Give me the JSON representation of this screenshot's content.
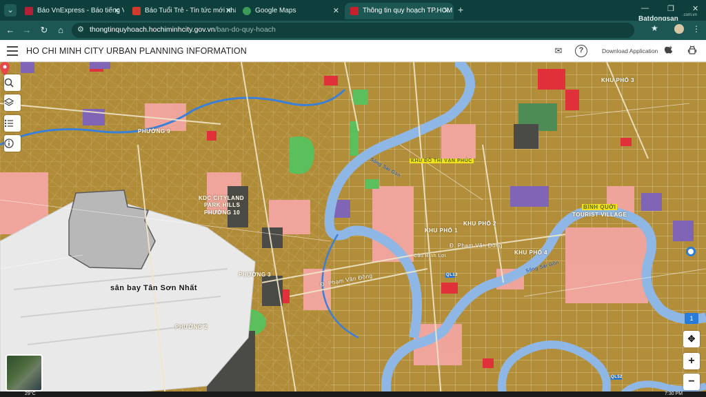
{
  "browser": {
    "tabs": [
      {
        "title": "Báo VnExpress - Báo tiếng Việt",
        "favicon_color": "#b2203a",
        "active": false
      },
      {
        "title": "Báo Tuổi Trẻ - Tin tức mới nhất",
        "favicon_color": "#d23a2a",
        "active": false
      },
      {
        "title": "Google Maps",
        "favicon_color": "#3a9b5b",
        "active": false
      },
      {
        "title": "Thông tin quy hoạch TP.HCM",
        "favicon_color": "#c8202b",
        "active": true
      }
    ],
    "new_tab_label": "+",
    "url_host": "thongtinquyhoach.hochiminhcity.gov.vn",
    "url_path": "/ban-do-quy-hoach",
    "watermark_brand": "Batdongsan",
    "watermark_sub": ".com.vn"
  },
  "site": {
    "title": "HO CHI MINH CITY URBAN PLANNING INFORMATION",
    "download_label": "Download Application"
  },
  "map": {
    "labels": {
      "airport": "sân bay Tân Sơn Nhất",
      "phuong10": "PHƯỜNG 10",
      "cityland": "KDC CITYLAND",
      "parkhills": "PARK HILLS",
      "phuong3": "PHƯỜNG 3",
      "phuong2": "PHƯỜNG 2",
      "phuong9": "PHƯỜNG 9",
      "khupho3": "KHU PHỐ 3",
      "khupho1": "KHU PHỐ 1",
      "khupho2": "KHU PHỐ 2",
      "khupho4": "KHU PHỐ 4",
      "kdtvanphuc": "KHU ĐÔ THỊ VẠN PHÚC",
      "binhquoi": "BÌNH QUỚI",
      "touristvillage": "TOURIST VILLAGE",
      "songsaigon": "Sông Sài Gòn",
      "songsaigon2": "Sông Sài Gòn",
      "phamvandong": "Đ. Phạm Văn Đồng",
      "phamvandong2": "Đ. Phạm Văn Đồng",
      "caubinhloi": "Cầu Bình Lợi",
      "ql13": "QL13",
      "ql52": "QL52"
    },
    "zoom_in_label": "+",
    "zoom_out_label": "−",
    "badge_count": "1"
  },
  "taskbar": {
    "temp": "29°C",
    "time": "7:30 PM"
  },
  "icons": {
    "search": "search-icon",
    "layers": "layers-icon",
    "legend": "legend-icon",
    "info": "info-icon",
    "mail": "mail-icon",
    "help": "help-icon",
    "apple": "apple-icon",
    "android": "android-icon",
    "locate": "locate-icon"
  },
  "colors": {
    "browser_frame": "#0f3f3c",
    "map_base": "#b38e3a",
    "river": "#8fb7e6",
    "zone_pink": "#f2a6a0",
    "zone_red": "#e0303a",
    "zone_purple": "#8064b5",
    "zone_green": "#5bbf5b"
  }
}
